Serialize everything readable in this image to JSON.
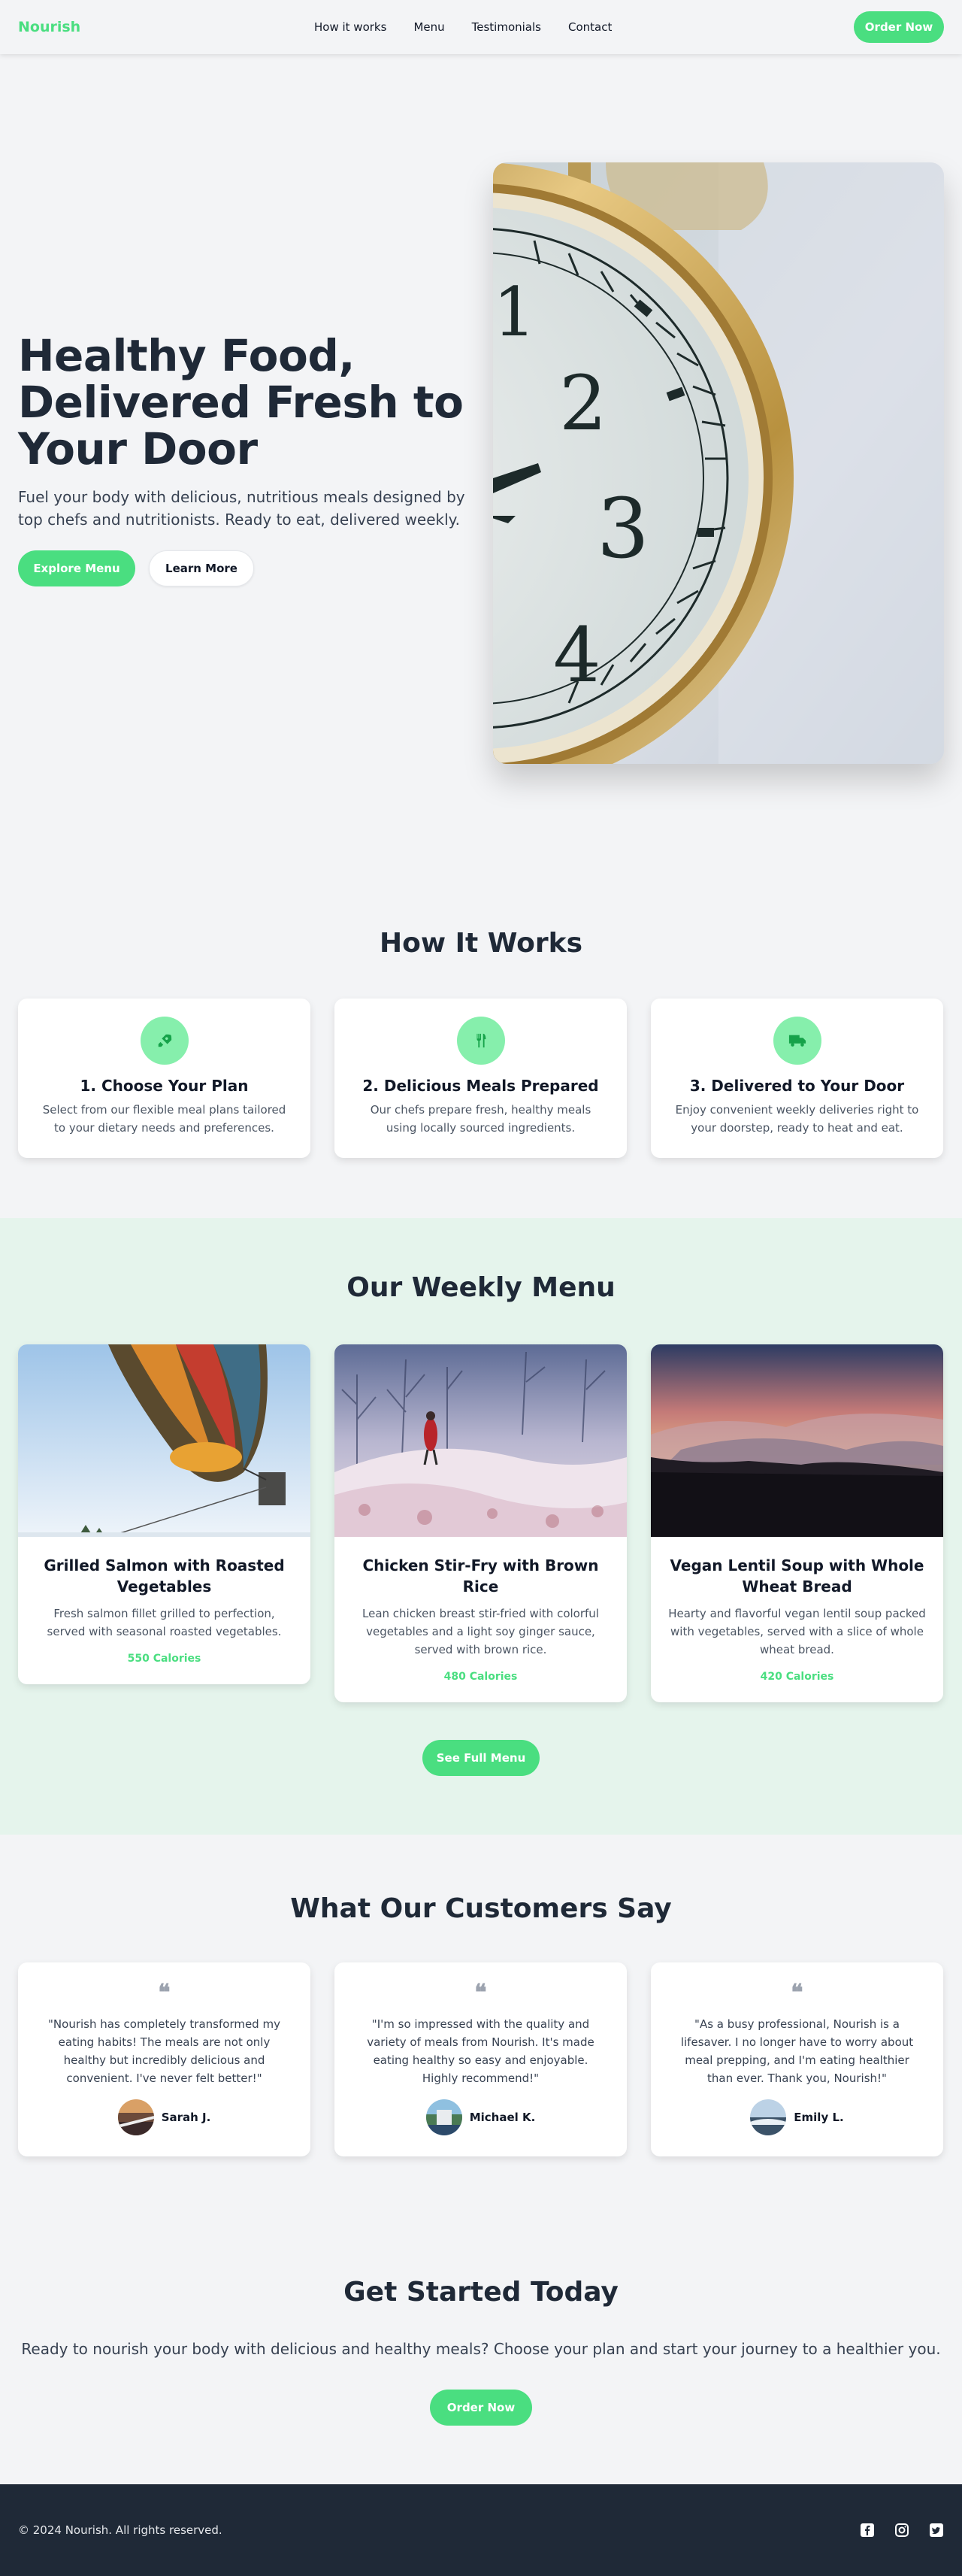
{
  "nav": {
    "brand": "Nourish",
    "links": [
      "How it works",
      "Menu",
      "Testimonials",
      "Contact"
    ],
    "cta": "Order Now"
  },
  "hero": {
    "title": "Healthy Food, Delivered Fresh to Your Door",
    "subtitle": "Fuel your body with delicious, nutritious meals designed by top chefs and nutritionists. Ready to eat, delivered weekly.",
    "primary_button": "Explore Menu",
    "secondary_button": "Learn More"
  },
  "how": {
    "title": "How It Works",
    "steps": [
      {
        "icon": "rocket-icon",
        "title": "1. Choose Your Plan",
        "desc": "Select from our flexible meal plans tailored to your dietary needs and preferences."
      },
      {
        "icon": "utensils-icon",
        "title": "2. Delicious Meals Prepared",
        "desc": "Our chefs prepare fresh, healthy meals using locally sourced ingredients."
      },
      {
        "icon": "truck-icon",
        "title": "3. Delivered to Your Door",
        "desc": "Enjoy convenient weekly deliveries right to your doorstep, ready to heat and eat."
      }
    ]
  },
  "menu": {
    "title": "Our Weekly Menu",
    "items": [
      {
        "title": "Grilled Salmon with Roasted Vegetables",
        "desc": "Fresh salmon fillet grilled to perfection, served with seasonal roasted vegetables.",
        "calories": "550 Calories"
      },
      {
        "title": "Chicken Stir-Fry with Brown Rice",
        "desc": "Lean chicken breast stir-fried with colorful vegetables and a light soy ginger sauce, served with brown rice.",
        "calories": "480 Calories"
      },
      {
        "title": "Vegan Lentil Soup with Whole Wheat Bread",
        "desc": "Hearty and flavorful vegan lentil soup packed with vegetables, served with a slice of whole wheat bread.",
        "calories": "420 Calories"
      }
    ],
    "button": "See Full Menu"
  },
  "testimonials": {
    "title": "What Our Customers Say",
    "items": [
      {
        "quote": "\"Nourish has completely transformed my eating habits! The meals are not only healthy but incredibly delicious and convenient. I've never felt better!\"",
        "name": "Sarah J."
      },
      {
        "quote": "\"I'm so impressed with the quality and variety of meals from Nourish. It's made eating healthy so easy and enjoyable. Highly recommend!\"",
        "name": "Michael K."
      },
      {
        "quote": "\"As a busy professional, Nourish is a lifesaver. I no longer have to worry about meal prepping, and I'm eating healthier than ever. Thank you, Nourish!\"",
        "name": "Emily L."
      }
    ]
  },
  "cta": {
    "title": "Get Started Today",
    "text": "Ready to nourish your body with delicious and healthy meals? Choose your plan and start your journey to a healthier you.",
    "button": "Order Now"
  },
  "footer": {
    "copyright": "© 2024 Nourish. All rights reserved.",
    "socials": [
      "facebook-icon",
      "instagram-icon",
      "twitter-icon"
    ]
  },
  "colors": {
    "accent": "#4ade80",
    "accent_light": "#86efac",
    "menu_bg": "#e5f4ec",
    "footer_bg": "#1f2937",
    "text_dark": "#1f2937"
  }
}
